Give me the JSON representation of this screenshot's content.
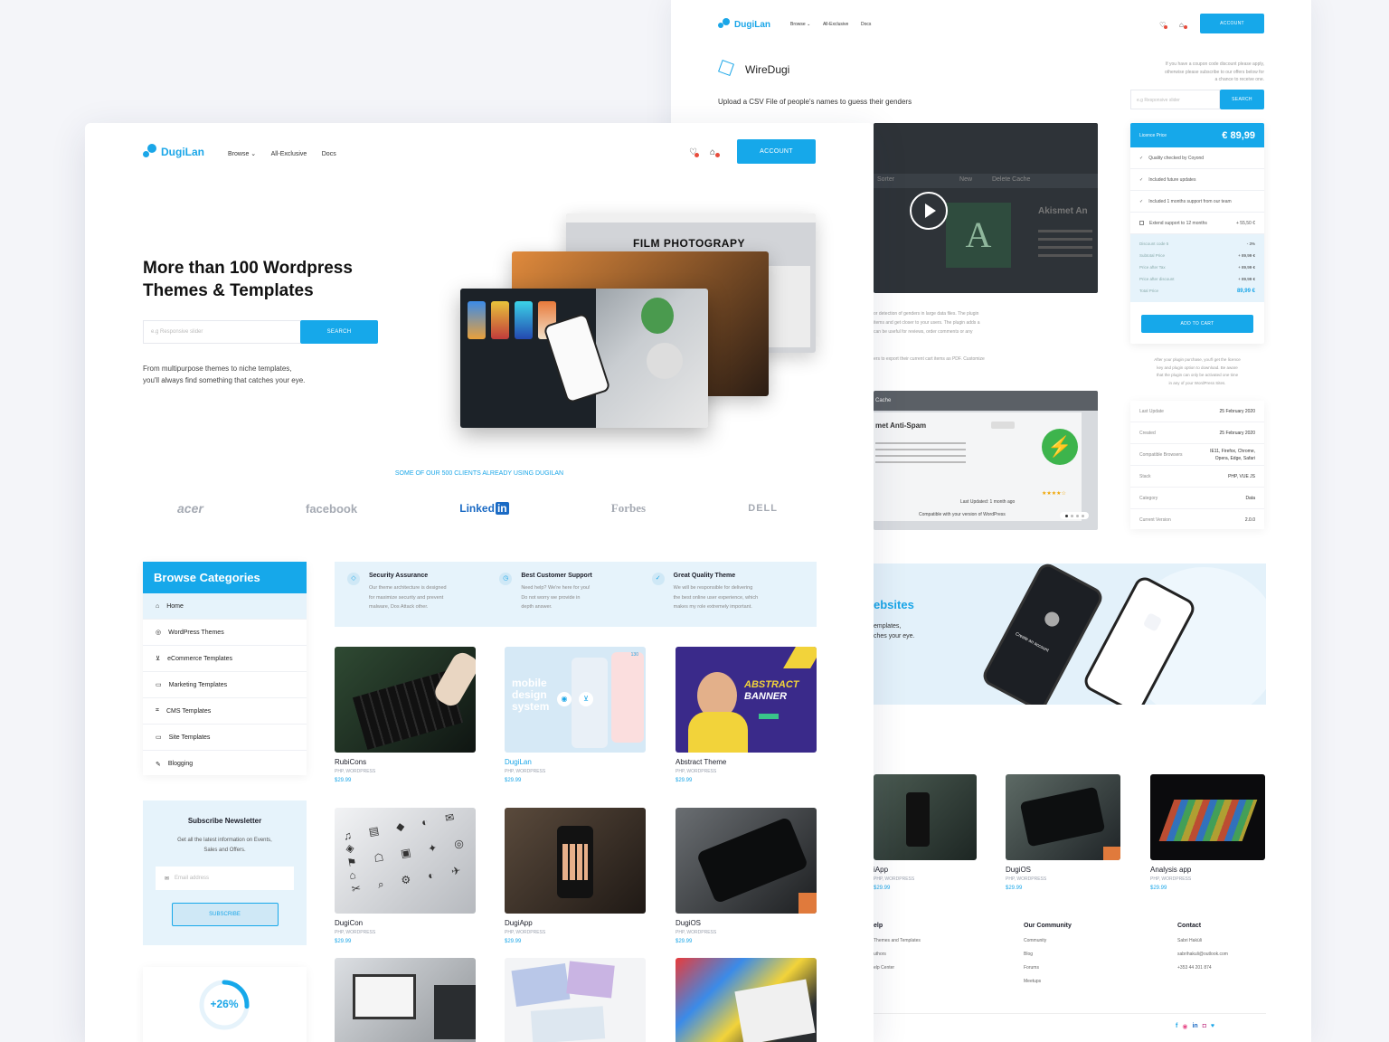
{
  "brand": "DugiLan",
  "nav": {
    "browse": "Browse",
    "all_exclusive": "All-Exclusive",
    "docs": "Docs",
    "account": "ACCOUNT"
  },
  "hero": {
    "title_line1": "More than 100 Wordpress",
    "title_line2": "Themes & Templates",
    "search_placeholder": "e.g Responsive slider",
    "search_button": "SEARCH",
    "subtitle_line1": "From multipurpose themes to niche templates,",
    "subtitle_line2": "you'll always find something that catches your eye.",
    "image_caption": "FILM PHOTOGRAPY"
  },
  "clients": {
    "label": "SOME OF OUR 500 CLIENTS ALREADY USING DUGILAN",
    "logos": [
      "acer",
      "facebook",
      "Linked",
      "in",
      "Forbes",
      "DELL"
    ]
  },
  "categories": {
    "title": "Browse Categories",
    "items": [
      "Home",
      "WordPress Themes",
      "eCommerce Templates",
      "Marketing Templates",
      "CMS Templates",
      "Site Templates",
      "Blogging"
    ]
  },
  "features": [
    {
      "title": "Security Assurance",
      "line1": "Our theme architecture is designed",
      "line2": "for maximize security and prevent",
      "line3": "malware, Dos Attack other."
    },
    {
      "title": "Best Customer Support",
      "line1": "Need help? We're here for you!",
      "line2": "Do not worry we provide in",
      "line3": "depth answer."
    },
    {
      "title": "Great Quality Theme",
      "line1": "We will be responsible for delivering",
      "line2": "the best online user experience, which",
      "line3": "makes my role extremely important."
    }
  ],
  "products": [
    {
      "name": "RubiCons",
      "meta": "PHP, WORDPRESS",
      "price": "$29.99"
    },
    {
      "name": "DugiLan",
      "meta": "PHP, WORDPRESS",
      "price": "$29.99",
      "overlay_line1": "mobile",
      "overlay_line2": "design",
      "overlay_line3": "system",
      "badge": "130"
    },
    {
      "name": "Abstract Theme",
      "meta": "PHP, WORDPRESS",
      "price": "$29.99",
      "overlay_line1": "ABSTRACT",
      "overlay_line2": "BANNER"
    },
    {
      "name": "DugiCon",
      "meta": "PHP, WORDPRESS",
      "price": "$29.99"
    },
    {
      "name": "DugiApp",
      "meta": "PHP, WORDPRESS",
      "price": "$29.99"
    },
    {
      "name": "DugiOS",
      "meta": "PHP, WORDPRESS",
      "price": "$29.99"
    }
  ],
  "newsletter": {
    "title": "Subscribe Newsletter",
    "line1": "Get all the latest information on Events,",
    "line2": "Sales and Offers.",
    "placeholder": "Email address",
    "button": "SUBSCRIBE"
  },
  "stat": {
    "value": "+26%",
    "progress": 0.26
  },
  "detail": {
    "product_name": "WireDugi",
    "description": "Upload a CSV File of people's names to guess their genders",
    "coupon_line1": "If you have a coupon code discount please apply,",
    "coupon_line2": "otherwise please subscribe to our offers below for",
    "coupon_line3": "a chance to receive one.",
    "coupon_placeholder": "e.g Responsive slider",
    "coupon_button": "SEARCH",
    "license_label": "Licence Price",
    "license_price": "€ 89,99",
    "checks": [
      "Quality checked by Coyond",
      "Included future updates",
      "Included 1 months support from our team"
    ],
    "extend_label": "Extend support to 12 months",
    "extend_price": "+ 55,50 €",
    "summary": [
      {
        "label": "Discount code 5",
        "value": "- 3%"
      },
      {
        "label": "Subtotal Price",
        "value": "+ 89,99 €"
      },
      {
        "label": "Price after Tax",
        "value": "+ 89,99 €"
      },
      {
        "label": "Price after discount",
        "value": "+ 89,99 €"
      }
    ],
    "total_label": "Total Price",
    "total_value": "89,99 €",
    "add_to_cart": "ADD TO CART",
    "purchase_note_1": "After your plugin purchase, you'll get the licence",
    "purchase_note_2": "key and plugin option to download. Be aware",
    "purchase_note_3": "that the plugin can only be activated one time",
    "purchase_note_4": "in any of your WordPress Sites.",
    "info": [
      {
        "label": "Last Update",
        "value": "25 February 2020"
      },
      {
        "label": "Created",
        "value": "25 February 2020"
      },
      {
        "label": "Compatible Browsers",
        "value": "IE11, Firefox, Chrome, Opera, Edge, Safari"
      },
      {
        "label": "Stack",
        "value": "PHP, VUE JS"
      },
      {
        "label": "Category",
        "value": "Data"
      },
      {
        "label": "Current Version",
        "value": "2.0.0"
      }
    ],
    "text_lines": [
      "or detection of genders in large data files. The plugin",
      "items and get closer to your users. The plugin adds a",
      "can be useful for reviews, order comments or any",
      "ers to export their current cart items as PDF. Customize"
    ],
    "video_words": [
      "Akismet An",
      "New",
      "Delete Cache",
      "Sorter"
    ],
    "slide2_title": "met Anti-Spam",
    "slide2_tab": "Cache",
    "slide2_updated": "Last Updated: 1 month ago",
    "slide2_compatible": "Compatible with your version of WordPress"
  },
  "promo": {
    "title_fragment": "ebsites",
    "line1": "emplates,",
    "line2": "ches your eye.",
    "phone_text": "Create an account"
  },
  "back_products": [
    {
      "name": "iApp",
      "meta": "PHP, WORDPRESS",
      "price": "$29.99"
    },
    {
      "name": "DugiOS",
      "meta": "PHP, WORDPRESS",
      "price": "$29.99"
    },
    {
      "name": "Analysis app",
      "meta": "PHP, WORDPRESS",
      "price": "$29.99"
    }
  ],
  "footer": {
    "help_title": "elp",
    "help_links": [
      "Themes and Templates",
      "uthors",
      "elp Center"
    ],
    "community_title": "Our Community",
    "community_links": [
      "Community",
      "Blog",
      "Forums",
      "Meetups"
    ],
    "contact_title": "Contact",
    "contact_lines": [
      "Sabri Haküli",
      "sabrihakuli@outlook.com",
      "+353 44 201 874"
    ]
  },
  "colors": {
    "accent": "#16a8ea",
    "light_blue": "#e6f3fb"
  }
}
